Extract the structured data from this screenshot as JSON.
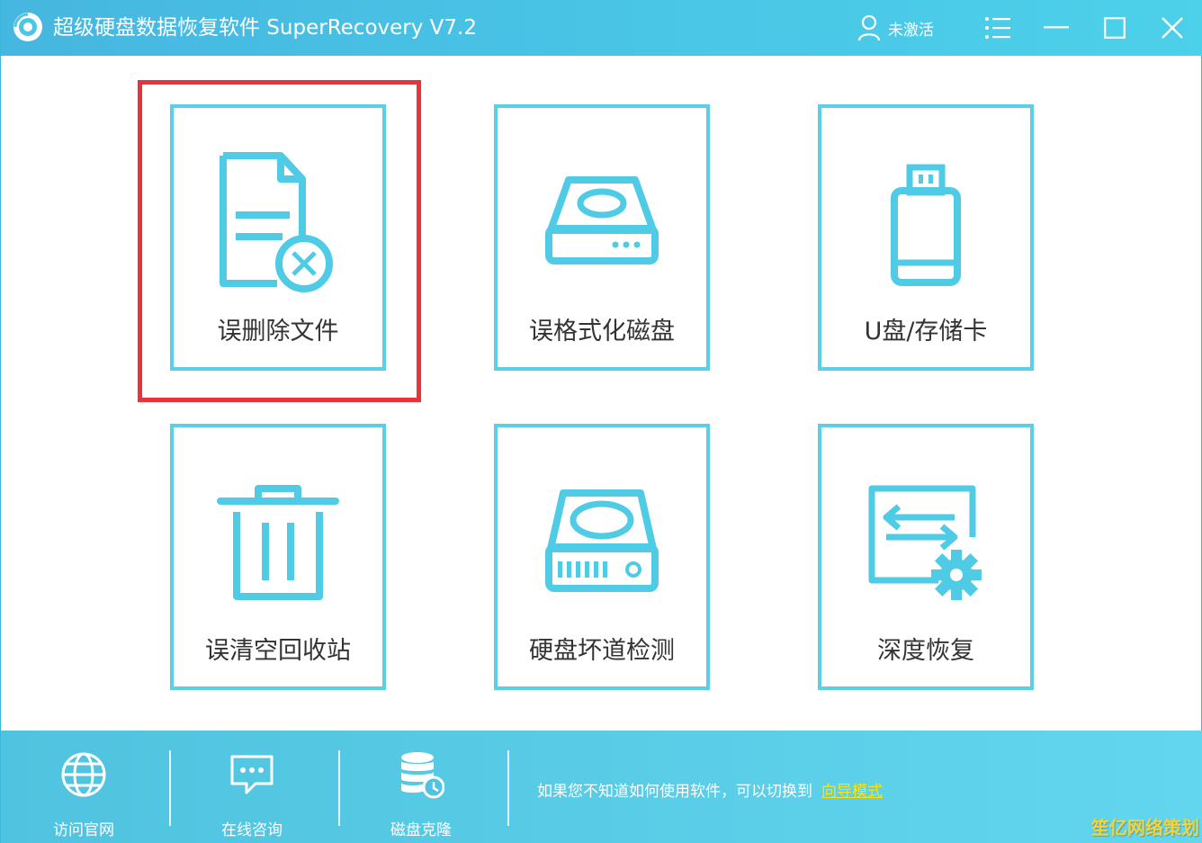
{
  "titlebar": {
    "title": "超级硬盘数据恢复软件 SuperRecovery V7.2",
    "user_label": "未激活"
  },
  "cards": [
    {
      "label": "误删除文件",
      "icon": "deleted-file-icon"
    },
    {
      "label": "误格式化磁盘",
      "icon": "hard-disk-icon"
    },
    {
      "label": "U盘/存储卡",
      "icon": "usb-drive-icon"
    },
    {
      "label": "误清空回收站",
      "icon": "trash-icon"
    },
    {
      "label": "硬盘坏道检测",
      "icon": "disk-check-icon"
    },
    {
      "label": "深度恢复",
      "icon": "deep-recovery-icon"
    }
  ],
  "bottom": {
    "tools": [
      {
        "label": "访问官网",
        "icon": "globe-icon"
      },
      {
        "label": "在线咨询",
        "icon": "chat-icon"
      },
      {
        "label": "磁盘克隆",
        "icon": "database-clone-icon"
      }
    ],
    "hint_text": "如果您不知道如何使用软件，可以切换到",
    "hint_link": "向导模式"
  },
  "watermark": "笙亿网络策划",
  "colors": {
    "accent": "#5ad0e8",
    "titlebar": "#4cc6e6",
    "highlight": "#ec3238",
    "link": "#ffe400"
  }
}
